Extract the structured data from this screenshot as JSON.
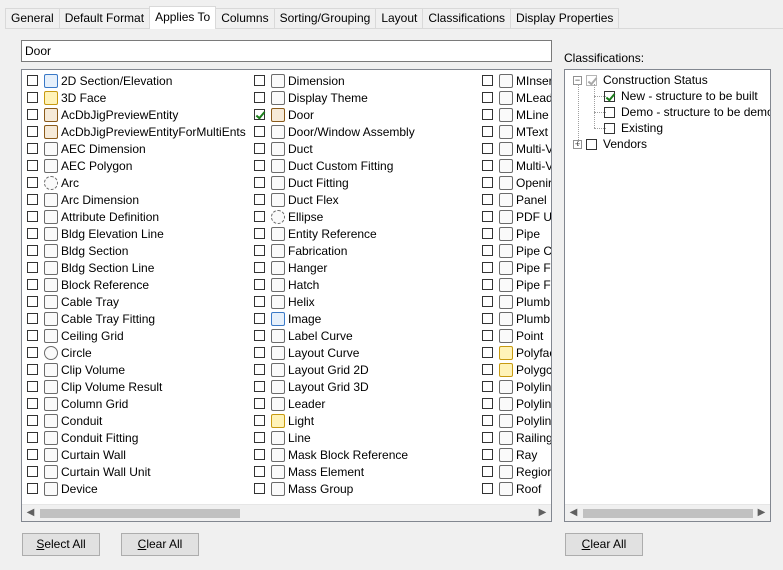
{
  "tabs": [
    "General",
    "Default Format",
    "Applies To",
    "Columns",
    "Sorting/Grouping",
    "Layout",
    "Classifications",
    "Display Properties"
  ],
  "active_tab": "Applies To",
  "search": {
    "value": "Door"
  },
  "columns": [
    [
      {
        "label": "2D Section/Elevation",
        "checked": false,
        "icon": "section-elevation-icon"
      },
      {
        "label": "3D Face",
        "checked": false,
        "icon": "3d-face-icon"
      },
      {
        "label": "AcDbJigPreviewEntity",
        "checked": false,
        "icon": "brush-icon"
      },
      {
        "label": "AcDbJigPreviewEntityForMultiEnts",
        "checked": false,
        "icon": "brush-icon"
      },
      {
        "label": "AEC Dimension",
        "checked": false,
        "icon": "aec-dimension-icon"
      },
      {
        "label": "AEC Polygon",
        "checked": false,
        "icon": "polygon-icon"
      },
      {
        "label": "Arc",
        "checked": false,
        "icon": "arc-icon"
      },
      {
        "label": "Arc Dimension",
        "checked": false,
        "icon": "arc-dimension-icon"
      },
      {
        "label": "Attribute Definition",
        "checked": false,
        "icon": "attribute-icon"
      },
      {
        "label": "Bldg Elevation Line",
        "checked": false,
        "icon": "elevation-line-icon"
      },
      {
        "label": "Bldg Section",
        "checked": false,
        "icon": "bldg-section-icon"
      },
      {
        "label": "Bldg Section Line",
        "checked": false,
        "icon": "section-line-icon"
      },
      {
        "label": "Block Reference",
        "checked": false,
        "icon": "block-reference-icon"
      },
      {
        "label": "Cable Tray",
        "checked": false,
        "icon": "cable-tray-icon"
      },
      {
        "label": "Cable Tray Fitting",
        "checked": false,
        "icon": "cable-tray-fitting-icon"
      },
      {
        "label": "Ceiling Grid",
        "checked": false,
        "icon": "ceiling-grid-icon"
      },
      {
        "label": "Circle",
        "checked": false,
        "icon": "circle-icon"
      },
      {
        "label": "Clip Volume",
        "checked": false,
        "icon": "clip-volume-icon"
      },
      {
        "label": "Clip Volume Result",
        "checked": false,
        "icon": "clip-volume-result-icon"
      },
      {
        "label": "Column Grid",
        "checked": false,
        "icon": "column-grid-icon"
      },
      {
        "label": "Conduit",
        "checked": false,
        "icon": "conduit-icon"
      },
      {
        "label": "Conduit Fitting",
        "checked": false,
        "icon": "conduit-fitting-icon"
      },
      {
        "label": "Curtain Wall",
        "checked": false,
        "icon": "curtain-wall-icon"
      },
      {
        "label": "Curtain Wall Unit",
        "checked": false,
        "icon": "curtain-wall-unit-icon"
      },
      {
        "label": "Device",
        "checked": false,
        "icon": "device-icon"
      }
    ],
    [
      {
        "label": "Dimension",
        "checked": false,
        "icon": "dimension-icon"
      },
      {
        "label": "Display Theme",
        "checked": false,
        "icon": "display-theme-icon"
      },
      {
        "label": "Door",
        "checked": true,
        "icon": "door-icon"
      },
      {
        "label": "Door/Window Assembly",
        "checked": false,
        "icon": "door-window-assembly-icon"
      },
      {
        "label": "Duct",
        "checked": false,
        "icon": "duct-icon"
      },
      {
        "label": "Duct Custom Fitting",
        "checked": false,
        "icon": "duct-custom-fitting-icon"
      },
      {
        "label": "Duct Fitting",
        "checked": false,
        "icon": "duct-fitting-icon"
      },
      {
        "label": "Duct Flex",
        "checked": false,
        "icon": "duct-flex-icon"
      },
      {
        "label": "Ellipse",
        "checked": false,
        "icon": "ellipse-icon"
      },
      {
        "label": "Entity Reference",
        "checked": false,
        "icon": "entity-reference-icon"
      },
      {
        "label": "Fabrication",
        "checked": false,
        "icon": "fabrication-icon"
      },
      {
        "label": "Hanger",
        "checked": false,
        "icon": "hanger-icon"
      },
      {
        "label": "Hatch",
        "checked": false,
        "icon": "hatch-icon"
      },
      {
        "label": "Helix",
        "checked": false,
        "icon": "helix-icon"
      },
      {
        "label": "Image",
        "checked": false,
        "icon": "image-icon"
      },
      {
        "label": "Label Curve",
        "checked": false,
        "icon": "label-curve-icon"
      },
      {
        "label": "Layout Curve",
        "checked": false,
        "icon": "layout-curve-icon"
      },
      {
        "label": "Layout Grid 2D",
        "checked": false,
        "icon": "layout-grid-2d-icon"
      },
      {
        "label": "Layout Grid 3D",
        "checked": false,
        "icon": "layout-grid-3d-icon"
      },
      {
        "label": "Leader",
        "checked": false,
        "icon": "leader-icon"
      },
      {
        "label": "Light",
        "checked": false,
        "icon": "light-bulb-icon"
      },
      {
        "label": "Line",
        "checked": false,
        "icon": "line-icon"
      },
      {
        "label": "Mask Block Reference",
        "checked": false,
        "icon": "mask-block-icon"
      },
      {
        "label": "Mass Element",
        "checked": false,
        "icon": "mass-element-icon"
      },
      {
        "label": "Mass Group",
        "checked": false,
        "icon": "mass-group-icon"
      }
    ],
    [
      {
        "label": "MInser",
        "checked": false,
        "icon": "minsert-icon"
      },
      {
        "label": "MLead",
        "checked": false,
        "icon": "mleader-icon"
      },
      {
        "label": "MLine",
        "checked": false,
        "icon": "mline-icon"
      },
      {
        "label": "MText",
        "checked": false,
        "icon": "mtext-icon"
      },
      {
        "label": "Multi-V",
        "checked": false,
        "icon": "multi-view-icon"
      },
      {
        "label": "Multi-V",
        "checked": false,
        "icon": "multi-view-icon"
      },
      {
        "label": "Openir",
        "checked": false,
        "icon": "opening-icon"
      },
      {
        "label": "Panel",
        "checked": false,
        "icon": "panel-icon"
      },
      {
        "label": "PDF Ur",
        "checked": false,
        "icon": "pdf-icon"
      },
      {
        "label": "Pipe",
        "checked": false,
        "icon": "pipe-icon"
      },
      {
        "label": "Pipe C",
        "checked": false,
        "icon": "pipe-custom-icon"
      },
      {
        "label": "Pipe Fi",
        "checked": false,
        "icon": "pipe-fitting-icon"
      },
      {
        "label": "Pipe Fl",
        "checked": false,
        "icon": "pipe-flex-icon"
      },
      {
        "label": "Plumb",
        "checked": false,
        "icon": "plumbing-icon"
      },
      {
        "label": "Plumb",
        "checked": false,
        "icon": "plumbing-line-icon"
      },
      {
        "label": "Point",
        "checked": false,
        "icon": "point-icon"
      },
      {
        "label": "Polyfac",
        "checked": false,
        "icon": "polyface-icon"
      },
      {
        "label": "Polygc",
        "checked": false,
        "icon": "polygon-mesh-icon"
      },
      {
        "label": "Polylin",
        "checked": false,
        "icon": "polyline-icon"
      },
      {
        "label": "Polylin",
        "checked": false,
        "icon": "polyline-icon"
      },
      {
        "label": "Polylin",
        "checked": false,
        "icon": "polyline-3d-icon"
      },
      {
        "label": "Railing",
        "checked": false,
        "icon": "railing-icon"
      },
      {
        "label": "Ray",
        "checked": false,
        "icon": "ray-icon"
      },
      {
        "label": "Regior",
        "checked": false,
        "icon": "region-icon"
      },
      {
        "label": "Roof",
        "checked": false,
        "icon": "roof-icon"
      }
    ]
  ],
  "classifications": {
    "label": "Classifications:",
    "tree": [
      {
        "label": "Construction Status",
        "checked": true,
        "grey": true,
        "expander": "−",
        "indent": 0
      },
      {
        "label": "New - structure to be built",
        "checked": true,
        "grey": false,
        "expander": "",
        "indent": 1
      },
      {
        "label": "Demo - structure to be demolis",
        "checked": false,
        "grey": false,
        "expander": "",
        "indent": 1
      },
      {
        "label": "Existing",
        "checked": false,
        "grey": false,
        "expander": "",
        "indent": 1
      },
      {
        "label": "Vendors",
        "checked": false,
        "grey": false,
        "expander": "+",
        "indent": 0
      }
    ]
  },
  "buttons": {
    "select_all_u": "S",
    "select_all_rest": "elect All",
    "clear_all_u": "C",
    "clear_all_rest": "lear All",
    "clear_all2_u": "C",
    "clear_all2_rest": "lear All"
  }
}
